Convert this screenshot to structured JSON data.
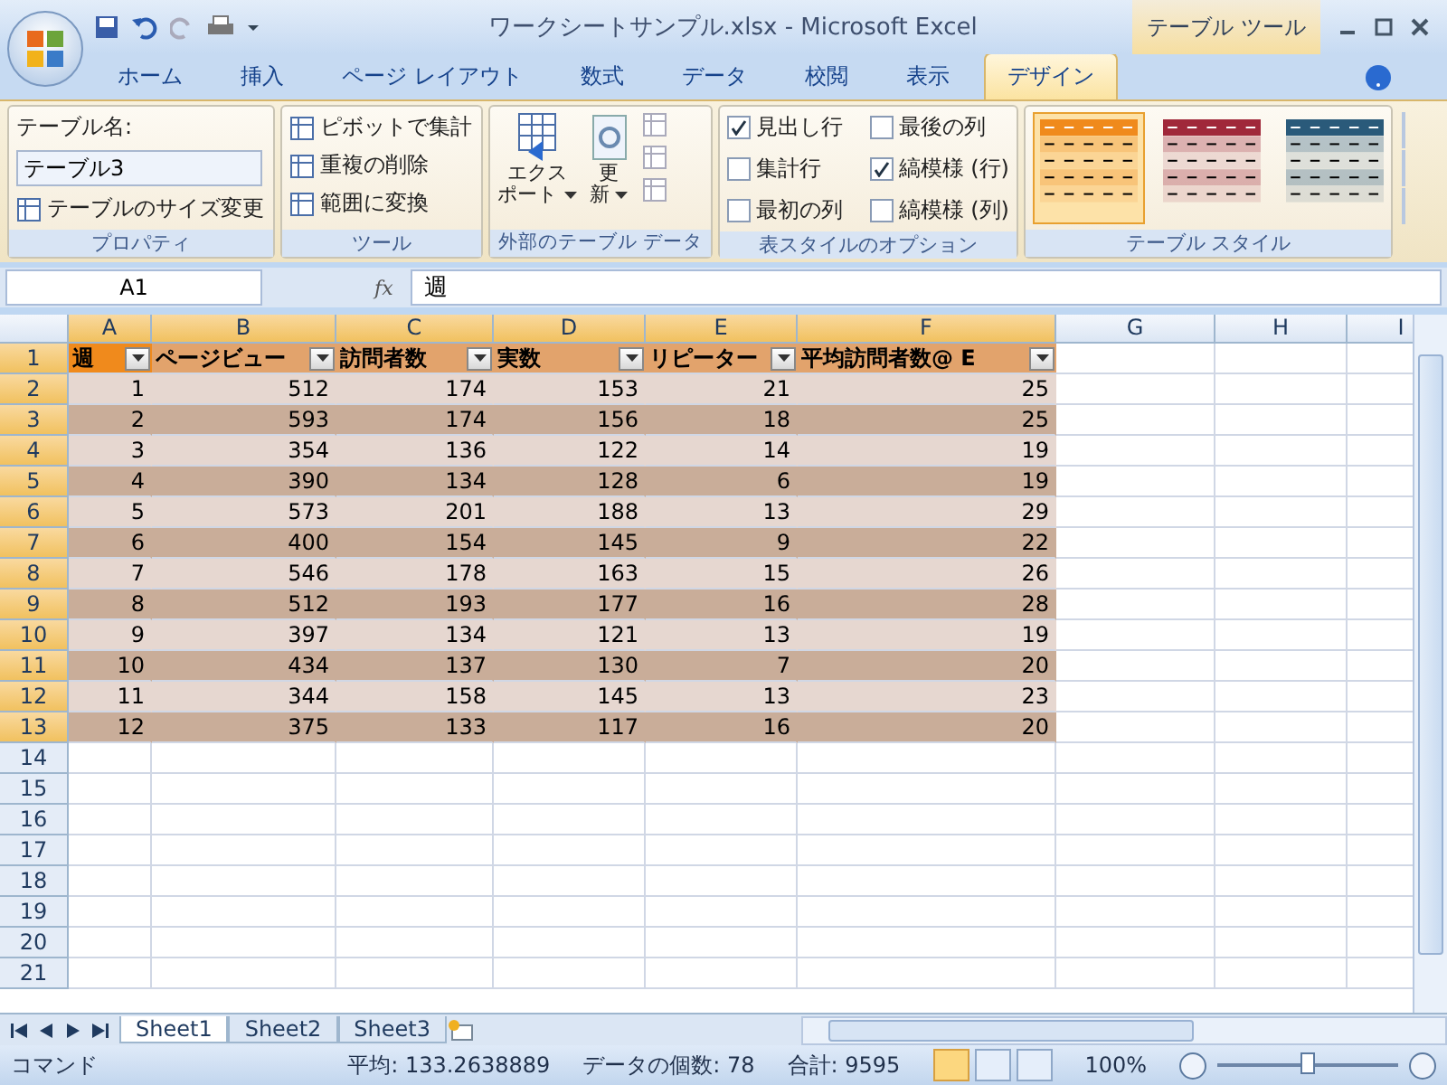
{
  "window": {
    "title": "ワークシートサンプル.xlsx - Microsoft Excel",
    "context_tab": "テーブル ツール"
  },
  "ribbon_tabs": [
    {
      "label": "ホーム",
      "selected": false
    },
    {
      "label": "挿入",
      "selected": false
    },
    {
      "label": "ページ レイアウト",
      "selected": false
    },
    {
      "label": "数式",
      "selected": false
    },
    {
      "label": "データ",
      "selected": false
    },
    {
      "label": "校閲",
      "selected": false
    },
    {
      "label": "表示",
      "selected": false
    },
    {
      "label": "デザイン",
      "selected": true
    }
  ],
  "properties": {
    "name_label": "テーブル名:",
    "name_value": "テーブル3",
    "resize": "テーブルのサイズ変更",
    "group": "プロパティ"
  },
  "tools": {
    "items": [
      "ピボットで集計",
      "重複の削除",
      "範囲に変換"
    ],
    "group": "ツール"
  },
  "external": {
    "export": [
      "エクス",
      "ポート"
    ],
    "refresh": [
      "更",
      "新"
    ],
    "group": "外部のテーブル データ"
  },
  "style_options": {
    "items": [
      {
        "label": "見出し行",
        "checked": true
      },
      {
        "label": "集計行",
        "checked": false
      },
      {
        "label": "最初の列",
        "checked": false
      },
      {
        "label": "最後の列",
        "checked": false
      },
      {
        "label": "縞模様 (行)",
        "checked": true
      },
      {
        "label": "縞模様 (列)",
        "checked": false
      }
    ],
    "group": "表スタイルのオプション"
  },
  "table_styles": {
    "swatches": [
      {
        "color": "#f08a1c",
        "selected": true
      },
      {
        "color": "#a0283a",
        "selected": false
      },
      {
        "color": "#2a5a7a",
        "selected": false
      }
    ],
    "group": "テーブル スタイル"
  },
  "formula_bar": {
    "cell": "A1",
    "fx": "fx",
    "value": "週"
  },
  "columns": [
    "A",
    "B",
    "C",
    "D",
    "E",
    "F",
    "G",
    "H",
    "I"
  ],
  "header": [
    "週",
    "ページビュー",
    "訪問者数",
    "実数",
    "リピーター",
    "平均訪問者数@ E"
  ],
  "rows": [
    [
      "1",
      "512",
      "174",
      "153",
      "21",
      "25"
    ],
    [
      "2",
      "593",
      "174",
      "156",
      "18",
      "25"
    ],
    [
      "3",
      "354",
      "136",
      "122",
      "14",
      "19"
    ],
    [
      "4",
      "390",
      "134",
      "128",
      "6",
      "19"
    ],
    [
      "5",
      "573",
      "201",
      "188",
      "13",
      "29"
    ],
    [
      "6",
      "400",
      "154",
      "145",
      "9",
      "22"
    ],
    [
      "7",
      "546",
      "178",
      "163",
      "15",
      "26"
    ],
    [
      "8",
      "512",
      "193",
      "177",
      "16",
      "28"
    ],
    [
      "9",
      "397",
      "134",
      "121",
      "13",
      "19"
    ],
    [
      "10",
      "434",
      "137",
      "130",
      "7",
      "20"
    ],
    [
      "11",
      "344",
      "158",
      "145",
      "13",
      "23"
    ],
    [
      "12",
      "375",
      "133",
      "117",
      "16",
      "20"
    ]
  ],
  "row_numbers": [
    "1",
    "2",
    "3",
    "4",
    "5",
    "6",
    "7",
    "8",
    "9",
    "10",
    "11",
    "12",
    "13",
    "14",
    "15",
    "16",
    "17",
    "18",
    "19",
    "20",
    "21"
  ],
  "sheets": [
    {
      "label": "Sheet1",
      "selected": true
    },
    {
      "label": "Sheet2",
      "selected": false
    },
    {
      "label": "Sheet3",
      "selected": false
    }
  ],
  "status_bar": {
    "mode": "コマンド",
    "average": "平均: 133.2638889",
    "count": "データの個数: 78",
    "sum": "合計: 9595",
    "views": [
      {
        "selected": true
      },
      {
        "selected": false
      },
      {
        "selected": false
      }
    ],
    "zoom": "100%",
    "zoom_level": {
      "level": 0.5
    }
  }
}
